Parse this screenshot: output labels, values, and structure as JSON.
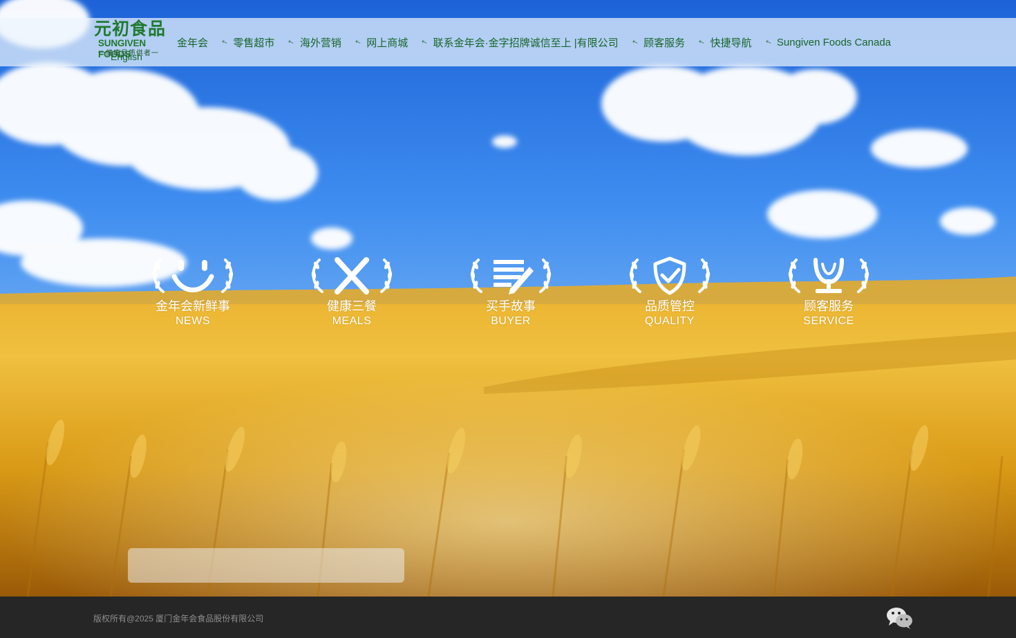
{
  "logo": {
    "cn": "元初食品",
    "en": "SUNGIVEN FOODS",
    "slogan": "一健康品质供者一"
  },
  "nav": {
    "items": [
      {
        "label": "金年会"
      },
      {
        "label": "零售超市"
      },
      {
        "label": "海外营销"
      },
      {
        "label": "网上商城"
      },
      {
        "label": "联系金年会·金字招牌诚信至上 |有限公司"
      },
      {
        "label": "顾客服务"
      },
      {
        "label": "快捷导航"
      },
      {
        "label": "Sungiven Foods Canada"
      }
    ],
    "lang": "English"
  },
  "features": [
    {
      "cn": "金年会新鲜事",
      "en": "NEWS",
      "icon": "smile-icon"
    },
    {
      "cn": "健康三餐",
      "en": "MEALS",
      "icon": "fork-knife-icon"
    },
    {
      "cn": "买手故事",
      "en": "BUYER",
      "icon": "document-pen-icon"
    },
    {
      "cn": "品质管控",
      "en": "QUALITY",
      "icon": "shield-check-icon"
    },
    {
      "cn": "顾客服务",
      "en": "SERVICE",
      "icon": "trophy-icon"
    }
  ],
  "footer": {
    "copyright": "版权所有@2025 厦门金年会食品股份有限公司",
    "wechat_icon": "wechat-icon"
  },
  "colors": {
    "nav_text": "#17662a",
    "footer_bg": "#262626",
    "sky_top": "#2a6fd6",
    "wheat": "#e0a51a"
  }
}
